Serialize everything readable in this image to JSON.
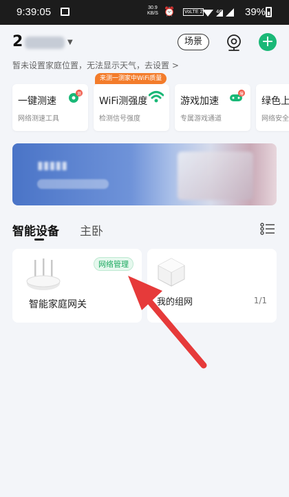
{
  "status_bar": {
    "time": "9:39:05",
    "net_speed_value": "30.9",
    "net_speed_unit": "KB/S",
    "volte": "VoLTE 2",
    "signal_label": "4G",
    "battery": "39%"
  },
  "header": {
    "home_name_visible": "2",
    "scene_button": "场景",
    "location_hint": "暂未设置家庭位置，无法显示天气，去设置 >"
  },
  "tools": [
    {
      "title": "一键测速",
      "subtitle": "网络测速工具",
      "icon": "speedtest-icon",
      "badge": "测"
    },
    {
      "title": "WiFi测强度",
      "subtitle": "检测信号强度",
      "icon": "wifi-icon"
    },
    {
      "title": "游戏加速",
      "subtitle": "专属游戏通道",
      "icon": "gamepad-icon",
      "badge": "爆"
    },
    {
      "title": "绿色上",
      "subtitle": "网络安全",
      "icon": "shield-icon"
    }
  ],
  "wifi_promo_badge": "来测一测家中WiFi质量",
  "tabs": [
    {
      "label": "智能设备",
      "active": true
    },
    {
      "label": "主卧",
      "active": false
    }
  ],
  "devices": [
    {
      "name": "智能家庭网关",
      "badge": "网络管理",
      "icon": "router-icon"
    },
    {
      "name": "我的组网",
      "count": "1/1",
      "icon": "mesh-node-icon"
    }
  ],
  "colors": {
    "accent_green": "#1ab877",
    "promo_orange": "#f37c2b",
    "annotation_red": "#e63a3a"
  }
}
